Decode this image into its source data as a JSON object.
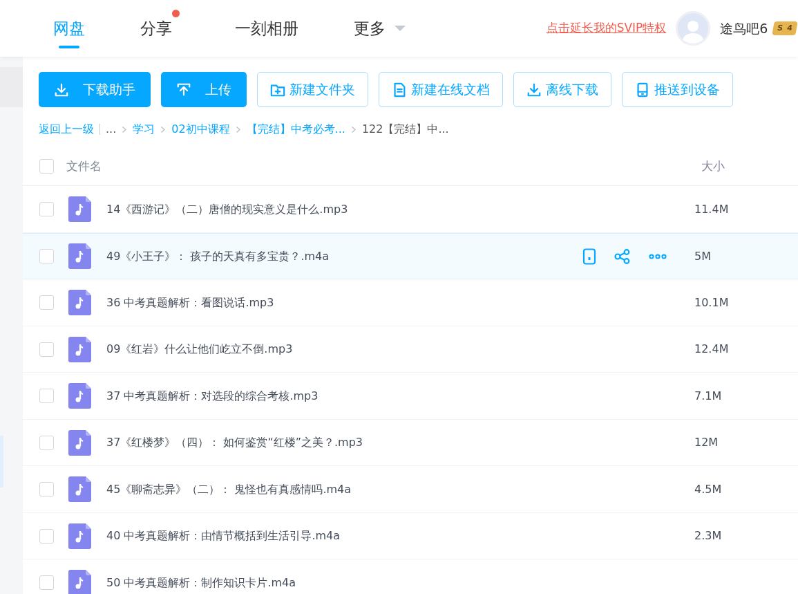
{
  "nav": {
    "tabs": [
      {
        "label": "网盘",
        "selected": true,
        "dot": false,
        "dropdown": false
      },
      {
        "label": "分享",
        "selected": false,
        "dot": true,
        "dropdown": false
      },
      {
        "label": "一刻相册",
        "selected": false,
        "dot": false,
        "dropdown": false
      },
      {
        "label": "更多",
        "selected": false,
        "dot": false,
        "dropdown": true
      }
    ]
  },
  "promo_link": "点击延长我的SVIP特权",
  "user": {
    "name": "途鸟吧6",
    "vip_symbol": "S",
    "vip_level": "4"
  },
  "toolbar": [
    {
      "label": "下载助手",
      "kind": "primary"
    },
    {
      "label": "上传",
      "kind": "primary"
    },
    {
      "label": "新建文件夹",
      "kind": "outline"
    },
    {
      "label": "新建在线文档",
      "kind": "outline"
    },
    {
      "label": "离线下载",
      "kind": "outline"
    },
    {
      "label": "推送到设备",
      "kind": "outline"
    }
  ],
  "breadcrumb": {
    "back": "返回上一级",
    "items": [
      {
        "label": "...",
        "kind": "text"
      },
      {
        "label": "学习",
        "kind": "link"
      },
      {
        "label": "02初中课程",
        "kind": "link"
      },
      {
        "label": "【完结】中考必考...",
        "kind": "link"
      },
      {
        "label": "122【完结】中...",
        "kind": "current"
      }
    ]
  },
  "table": {
    "columns": [
      "文件名",
      "大小"
    ],
    "header_checked": false,
    "rows": [
      {
        "name": "14《西游记》（二）唐僧的现实意义是什么.mp3",
        "size": "11.4M",
        "checked": false,
        "hovered": false
      },
      {
        "name": "49《小王子》： 孩子的天真有多宝贵？.m4a",
        "size": "5M",
        "checked": false,
        "hovered": true
      },
      {
        "name": "36 中考真题解析：看图说话.mp3",
        "size": "10.1M",
        "checked": false,
        "hovered": false
      },
      {
        "name": "09《红岩》什么让他们屹立不倒.mp3",
        "size": "12.4M",
        "checked": false,
        "hovered": false
      },
      {
        "name": "37 中考真题解析：对选段的综合考核.mp3",
        "size": "7.1M",
        "checked": false,
        "hovered": false
      },
      {
        "name": "37《红楼梦》（四）： 如何鉴赏“红楼”之美？.mp3",
        "size": "12M",
        "checked": false,
        "hovered": false
      },
      {
        "name": "45《聊斋志异》（二）： 鬼怪也有真感情吗.m4a",
        "size": "4.5M",
        "checked": false,
        "hovered": false
      },
      {
        "name": "40 中考真题解析：由情节概括到生活引导.m4a",
        "size": "2.3M",
        "checked": false,
        "hovered": false
      },
      {
        "name": "50 中考真题解析：制作知识卡片.m4a",
        "checked": false,
        "hovered": false
      }
    ]
  }
}
